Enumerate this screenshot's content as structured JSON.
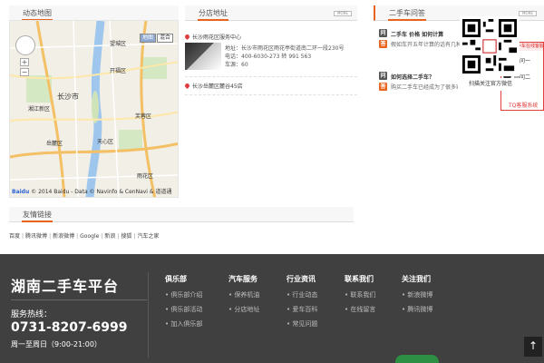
{
  "map_panel": {
    "heading": "动态地图",
    "labels": [
      "长沙市",
      "湘江新区",
      "开福区",
      "芙蓉区",
      "雨花区",
      "天心区",
      "岳麓区",
      "望城区"
    ],
    "map_types": [
      "地图",
      "混合"
    ],
    "copyright_brand": "Baidu",
    "copyright_text": "© 2014 Baidu - Data © Navinfo & CenNavi & 道道通"
  },
  "branch_panel": {
    "heading": "分店地址",
    "more": "MORE",
    "branches": [
      {
        "name": "长沙雨花区服务中心",
        "address": "地址：长沙市雨花区雨花亭街道南二环一段230号",
        "phone": "电话：400-6030-273 转 991 563",
        "seats": "车源：60"
      },
      {
        "name": "长沙岳麓区麓谷45店"
      }
    ]
  },
  "qa_panel": {
    "heading": "二手车问答",
    "more": "MORE",
    "items": [
      {
        "question": "二手车 价格 如何计算",
        "answer": "假如车开五年计算的话有几种情况你会也可卖，一台十万元的车计算（年），车..."
      },
      {
        "question": "如何选择二手车？",
        "answer": "购买二手车已经成为了很多家庭的消费热点，汽车基本身具有一定的价值，购买..."
      }
    ]
  },
  "chat_popup": {
    "header": "湖南二手车在线客服",
    "agents": [
      "顾问一",
      "顾问二"
    ],
    "footer": "TQ客服系统"
  },
  "friend_links": {
    "heading": "友情链接",
    "links": [
      "百度",
      "腾讯微博",
      "新浪微博",
      "Google",
      "新浪",
      "搜狐",
      "汽车之家"
    ]
  },
  "footer": {
    "brand": "湖南二手车平台",
    "hotline_label": "服务热线：",
    "hotline": "0731-8207-6999",
    "hours": "周一至周日（9:00-21:00）",
    "columns": [
      {
        "title": "俱乐部",
        "items": [
          "俱乐部介绍",
          "俱乐部活动",
          "加入俱乐部"
        ]
      },
      {
        "title": "汽车服务",
        "items": [
          "保养机油",
          "分店地址"
        ]
      },
      {
        "title": "行业资讯",
        "items": [
          "行业动态",
          "爱车百科",
          "常见问题"
        ]
      },
      {
        "title": "联系我们",
        "items": [
          "联系我们",
          "在线留言"
        ]
      },
      {
        "title": "关注我们",
        "items": [
          "新浪微博",
          "腾讯微博"
        ]
      }
    ],
    "qr_caption": "扫描关注官方微信",
    "back_to_top": "↑"
  },
  "colors": {
    "accent": "#e8641c",
    "footer_bg": "#404040",
    "chat_border": "#e23c3c"
  }
}
